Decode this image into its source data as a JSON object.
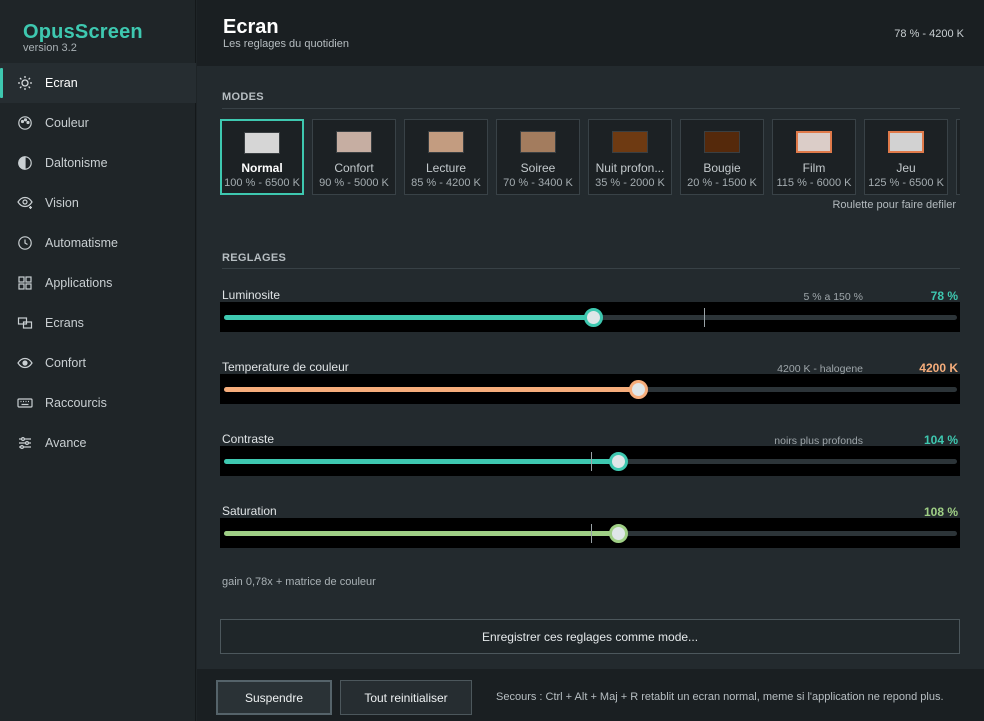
{
  "app": {
    "name": "OpusScreen",
    "version": "version 3.2"
  },
  "header": {
    "title": "Ecran",
    "subtitle": "Les reglages du quotidien",
    "status": "78 % - 4200 K"
  },
  "sidebar": {
    "items": [
      {
        "label": "Ecran",
        "icon": "sun-icon",
        "active": true
      },
      {
        "label": "Couleur",
        "icon": "palette-icon"
      },
      {
        "label": "Daltonisme",
        "icon": "contrast-icon"
      },
      {
        "label": "Vision",
        "icon": "eye-plus-icon"
      },
      {
        "label": "Automatisme",
        "icon": "clock-icon"
      },
      {
        "label": "Applications",
        "icon": "grid-icon"
      },
      {
        "label": "Ecrans",
        "icon": "monitors-icon"
      },
      {
        "label": "Confort",
        "icon": "eye-icon"
      },
      {
        "label": "Raccourcis",
        "icon": "keyboard-icon"
      },
      {
        "label": "Avance",
        "icon": "sliders-icon"
      }
    ]
  },
  "modes": {
    "label": "MODES",
    "hint": "Roulette pour faire defiler",
    "items": [
      {
        "name": "Normal",
        "meta": "100 % - 6500 K",
        "swatch": "#d6d6d6",
        "selected": true
      },
      {
        "name": "Confort",
        "meta": "90 % - 5000 K",
        "swatch": "#c6aea2"
      },
      {
        "name": "Lecture",
        "meta": "85 % - 4200 K",
        "swatch": "#c39c80"
      },
      {
        "name": "Soiree",
        "meta": "70 % - 3400 K",
        "swatch": "#a37c5e"
      },
      {
        "name": "Nuit profon...",
        "meta": "35 % - 2000 K",
        "swatch": "#6e3a12"
      },
      {
        "name": "Bougie",
        "meta": "20 % - 1500 K",
        "swatch": "#55290b"
      },
      {
        "name": "Film",
        "meta": "115 % - 6000 K",
        "swatch": "#dbcdc8",
        "swatch_border": "#e07a4a"
      },
      {
        "name": "Jeu",
        "meta": "125 % - 6500 K",
        "swatch": "#d2d2d2",
        "swatch_border": "#e07a4a"
      }
    ]
  },
  "reglages": {
    "label": "REGLAGES",
    "sliders": [
      {
        "name": "luminosite",
        "label": "Luminosite",
        "hint": "5 % a 150 %",
        "value_text": "78 %",
        "fraction": 0.504,
        "default_fraction": 0.655,
        "color": "#3ec8b0"
      },
      {
        "name": "temperature",
        "label": "Temperature de couleur",
        "hint": "4200 K - halogene",
        "value_text": "4200 K",
        "fraction": 0.566,
        "color": "#f6ad7b"
      },
      {
        "name": "contraste",
        "label": "Contraste",
        "hint": "noirs plus profonds",
        "value_text": "104 %",
        "fraction": 0.538,
        "default_fraction": 0.5,
        "color": "#3ec8b0"
      },
      {
        "name": "saturation",
        "label": "Saturation",
        "hint": "",
        "value_text": "108 %",
        "fraction": 0.538,
        "default_fraction": 0.5,
        "color": "#9fcf85"
      }
    ],
    "gain_note": "gain 0,78x + matrice de couleur",
    "save_label": "Enregistrer ces reglages comme mode..."
  },
  "footer": {
    "suspend_label": "Suspendre",
    "reset_label": "Tout reinitialiser",
    "help": "Secours : Ctrl + Alt + Maj + R retablit un ecran normal, meme si l'application ne repond plus."
  }
}
